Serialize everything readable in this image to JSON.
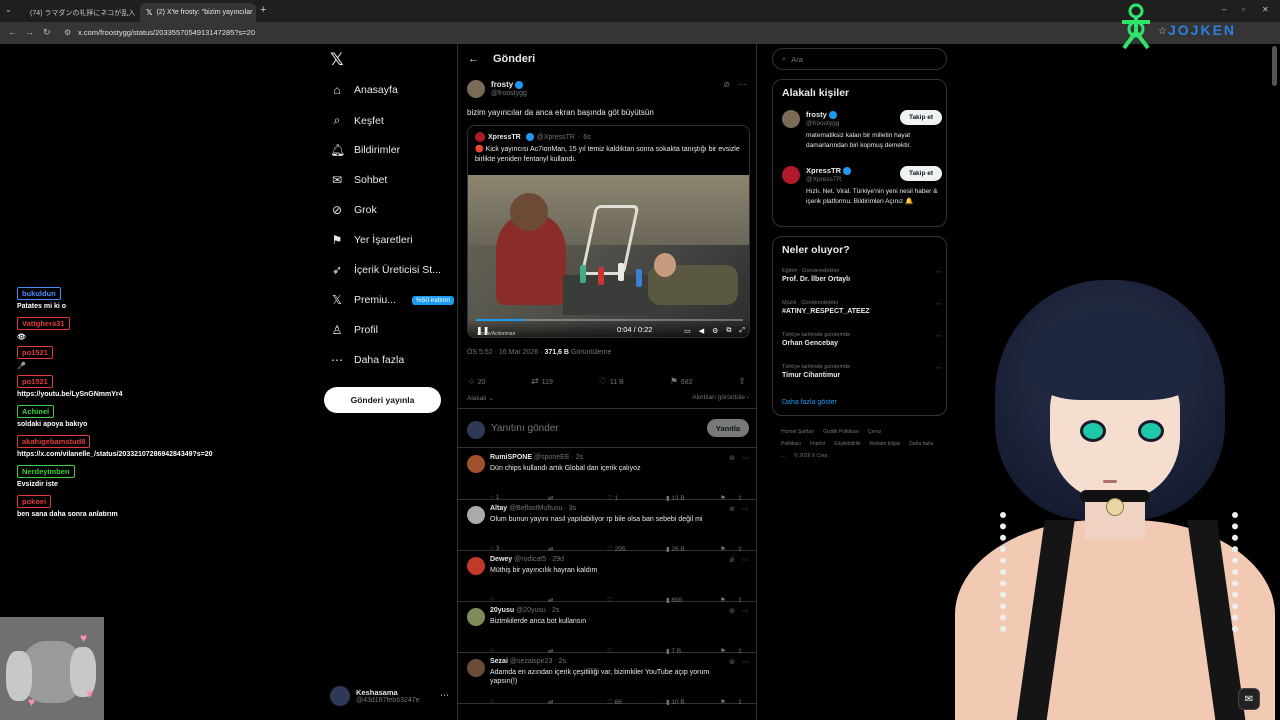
{
  "browser": {
    "tabs": [
      {
        "title": "(74) ラマダンの礼拝にネコが乱入",
        "icon": "youtube-icon"
      },
      {
        "title": "(2) X'te frosty: \"bizim yayıncılar",
        "icon": "x-icon"
      }
    ],
    "url": "x.com/froostygg/status/2033557054913147285?s=20"
  },
  "nav": {
    "items": [
      {
        "label": "Anasayfa",
        "icon": "home-icon"
      },
      {
        "label": "Keşfet",
        "icon": "search-icon"
      },
      {
        "label": "Bildirimler",
        "icon": "bell-icon"
      },
      {
        "label": "Sohbet",
        "icon": "mail-icon"
      },
      {
        "label": "Grok",
        "icon": "grok-icon"
      },
      {
        "label": "Yer İşaretleri",
        "icon": "bookmark-icon"
      },
      {
        "label": "İçerik Üreticisi St...",
        "icon": "rocket-icon"
      },
      {
        "label": "Premiu...",
        "icon": "x-icon"
      },
      {
        "label": "Profil",
        "icon": "person-icon"
      },
      {
        "label": "Daha fazla",
        "icon": "more-circle-icon"
      }
    ],
    "premium_badge": "%50 indirim",
    "post_button": "Gönderi yayınla",
    "account": {
      "name": "Keshasama",
      "handle": "@43d167feb63247e"
    }
  },
  "post": {
    "header": "Gönderi",
    "author_name": "frosty",
    "author_handle": "@froostygg",
    "text": "bizim yayıncılar da anca ekran başında göt büyütsün",
    "quote": {
      "author_name": "XpressTR",
      "author_handle": "@XpressTR",
      "age": "6s",
      "text": "🔴 Kick yayıncısı Ac7ionMan, 15 yıl temiz kaldıktan sonra sokakta tanıştığı bir evsizle birlikte yeniden fentanyl kullandı.",
      "video_time": "0:04 / 0:22",
      "video_progress": 0.18,
      "video_caption": "x.com/Actionman"
    },
    "timestamp": "ÖS 5:52 · 16 Mar 2026 · ",
    "views": "371,6 B",
    "views_label": " Görüntüleme",
    "stats": {
      "replies": "20",
      "reposts": "119",
      "likes": "11 B",
      "bookmarks": "682"
    },
    "related_label": "Alakalı",
    "quotes_label": "Alıntıları görüntüle",
    "reply_placeholder": "Yanıtını gönder",
    "reply_button": "Yanıtla"
  },
  "replies": [
    {
      "name": "RumiSPONE",
      "handle": "@sponeEE · 2s",
      "text": "Dün chips kullandı artık Global dan içerik çalıyoz",
      "replies": "1",
      "reposts": "",
      "likes": "1",
      "views": "13 B",
      "color": "#a0522d"
    },
    {
      "name": "Altay",
      "handle": "@BelfastMuftusu · 3s",
      "text": "Olum bunun yayını nasıl yapılabiliyor rp bile olsa ban sebebi değil mi",
      "replies": "3",
      "reposts": "",
      "likes": "295",
      "views": "26 B",
      "color": "#aaaaaa"
    },
    {
      "name": "Dewey",
      "handle": "@rodicat5 · 29d",
      "text": "Müthiş bir yayıncılık hayran kaldım",
      "replies": "",
      "reposts": "",
      "likes": "",
      "views": "690",
      "color": "#c0392b"
    },
    {
      "name": "20yusu",
      "handle": "@20yusu · 2s",
      "text": "Bizimkilerde anca bot kullansın",
      "replies": "",
      "reposts": "",
      "likes": "",
      "views": "7 B",
      "color": "#7f8c5a"
    },
    {
      "name": "Sezai",
      "handle": "@sezaispir23 · 2s",
      "text": "Adamda en azından içerik çeşitliliği var, bizimkiler YouTube açıp yorum yapsın(!)",
      "replies": "",
      "reposts": "",
      "likes": "66",
      "views": "10 B",
      "color": "#6b4a36"
    }
  ],
  "right": {
    "search_placeholder": "Ara",
    "related_title": "Alakalı kişiler",
    "people": [
      {
        "name": "frosty",
        "handle": "@froostygg",
        "bio": "matematiksiz kalan bir milletin hayat damarlarından biri kopmuş demektir.",
        "follow": "Takip et"
      },
      {
        "name": "XpressTR",
        "handle": "@XpressTR",
        "bio": "Hızlı. Net. Viral. Türkiye'nin yeni nesil haber & içerik platformu. Bildirimleri Açınız 🔔",
        "follow": "Takip et"
      }
    ],
    "trends_title": "Neler oluyor?",
    "trends": [
      {
        "category": "Eğitim · Gündemdekiler",
        "title": "Prof. Dr. İlber Ortaylı"
      },
      {
        "category": "Müzik · Gündemdekiler",
        "title": "#ATINY_RESPECT_ATEEZ"
      },
      {
        "category": "Türkiye tarihinde gündemde",
        "title": "Orhan Gencebay"
      },
      {
        "category": "Türkiye tarihinde gündemde",
        "title": "Timur Cihantimur"
      }
    ],
    "show_more": "Daha fazla göster",
    "footer": [
      "Hizmet Şartları",
      "Gizlilik Politikası",
      "Çerez Politikası",
      "Imprint",
      "Erişilebilirlik",
      "Reklam bilgisi",
      "Daha fazla ...",
      "© 2026 X Corp."
    ]
  },
  "stream_chat": [
    {
      "name": "bukuldun",
      "msg": "Patates mi ki o",
      "color": "#4a8cff"
    },
    {
      "name": "Vattghera31",
      "msg": "👁",
      "color": "#e03a3a"
    },
    {
      "name": "po1521",
      "msg": "🎤",
      "color": "#e03a3a"
    },
    {
      "name": "po1521",
      "msg": "https://youtu.be/LySnGNmmYr4",
      "color": "#e03a3a"
    },
    {
      "name": "Achinel",
      "msg": "soldaki apoya bakıyo",
      "color": "#3ad03a"
    },
    {
      "name": "akahigebamstud8",
      "msg": "https://x.com/vilanelle_/status/2033210728694284349?s=20",
      "color": "#e03a3a"
    },
    {
      "name": "Nerdeyimben",
      "msg": "Evsizdir iste",
      "color": "#3ad03a"
    },
    {
      "name": "pokoei",
      "msg": "ben sana daha sonra anlatırım",
      "color": "#e03a3a"
    }
  ],
  "overlay_logo_text": "JOJKEN"
}
